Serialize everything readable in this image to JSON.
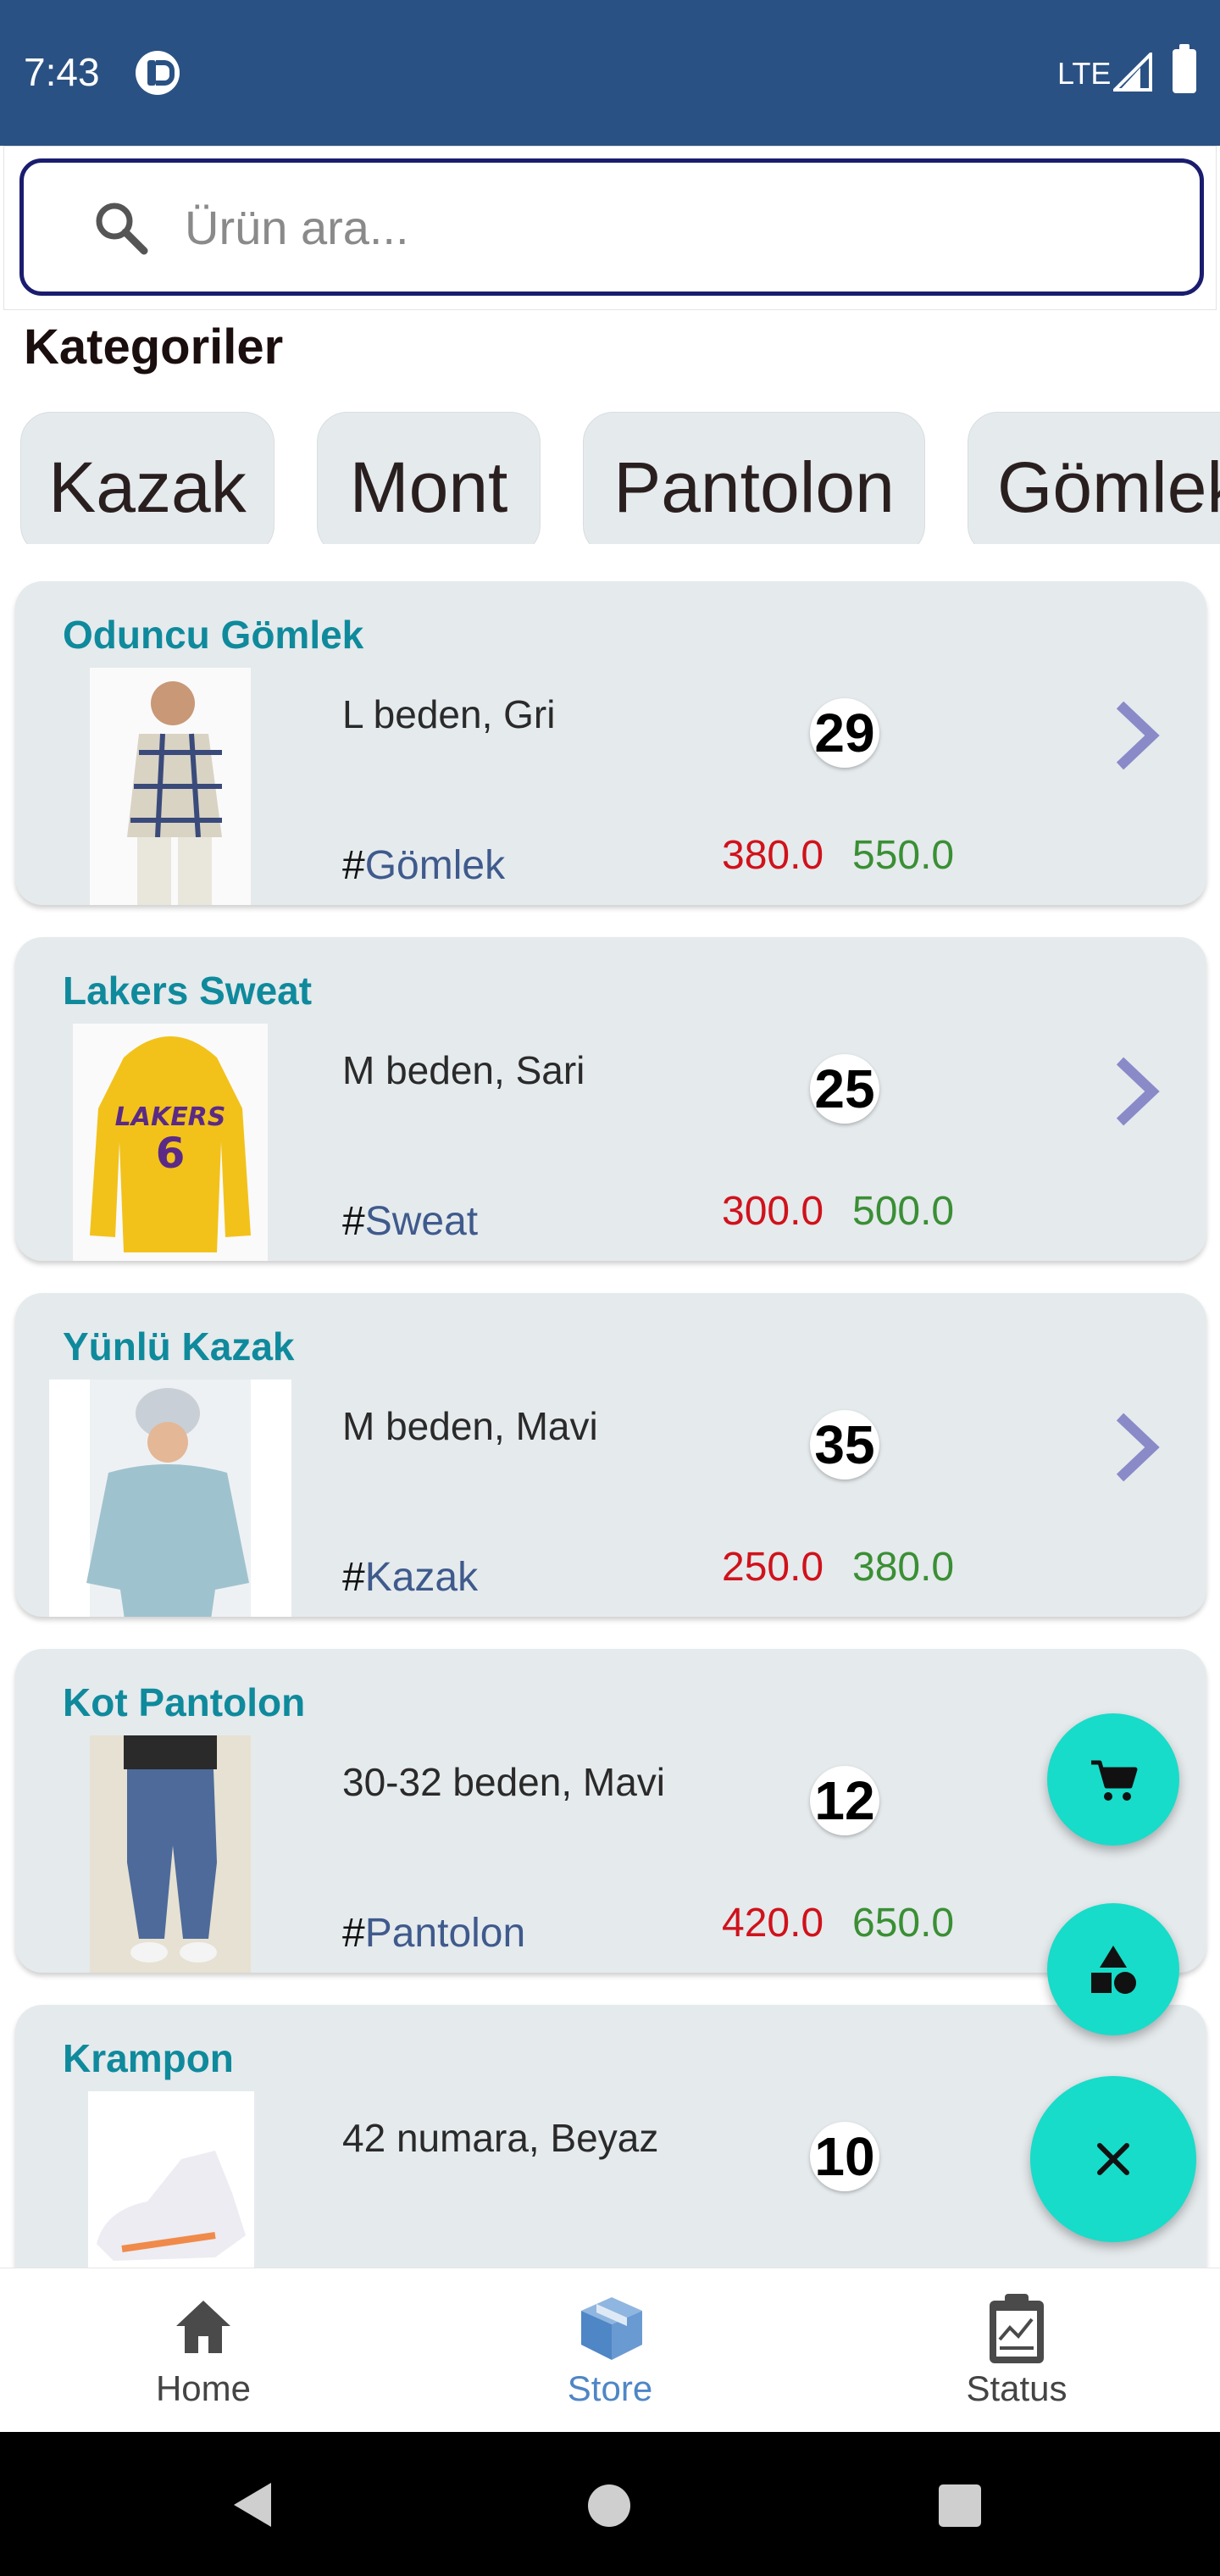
{
  "status_bar": {
    "time": "7:43",
    "network": "LTE",
    "icons": [
      "app-notification-icon",
      "signal-icon",
      "battery-icon"
    ]
  },
  "search": {
    "placeholder": "Ürün ara...",
    "icon": "search-icon",
    "border_color": "#1a1d6e"
  },
  "categories_section": {
    "title": "Kategoriler",
    "items": [
      "Kazak",
      "Mont",
      "Pantolon",
      "Gömlek"
    ]
  },
  "products": [
    {
      "name": "Oduncu Gömlek",
      "desc": "L beden, Gri",
      "tag": "Gömlek",
      "count": "29",
      "buy_price": "380.0",
      "sell_price": "550.0"
    },
    {
      "name": "Lakers Sweat",
      "desc": "M beden, Sari",
      "tag": "Sweat",
      "count": "25",
      "buy_price": "300.0",
      "sell_price": "500.0"
    },
    {
      "name": "Yünlü Kazak",
      "desc": "M beden, Mavi",
      "tag": "Kazak",
      "count": "35",
      "buy_price": "250.0",
      "sell_price": "380.0"
    },
    {
      "name": "Kot Pantolon",
      "desc": "30-32 beden, Mavi",
      "tag": "Pantolon",
      "count": "12",
      "buy_price": "420.0",
      "sell_price": "650.0"
    },
    {
      "name": "Krampon",
      "desc": "42 numara, Beyaz",
      "tag": "",
      "count": "10",
      "buy_price": "",
      "sell_price": ""
    }
  ],
  "tag_prefix": "#",
  "fabs": [
    {
      "icon": "cart-icon"
    },
    {
      "icon": "shapes-icon"
    },
    {
      "icon": "close-icon"
    }
  ],
  "bottom_nav": {
    "items": [
      {
        "label": "Home",
        "icon": "home-icon",
        "active": false
      },
      {
        "label": "Store",
        "icon": "store-box-icon",
        "active": true
      },
      {
        "label": "Status",
        "icon": "clipboard-chart-icon",
        "active": false
      }
    ]
  },
  "colors": {
    "status_bar": "#2a5183",
    "accent_fab": "#17dcc9",
    "product_title": "#0f8a9c",
    "buy_price": "#d0121b",
    "sell_price": "#3a8f34",
    "nav_active": "#4f86c6"
  }
}
